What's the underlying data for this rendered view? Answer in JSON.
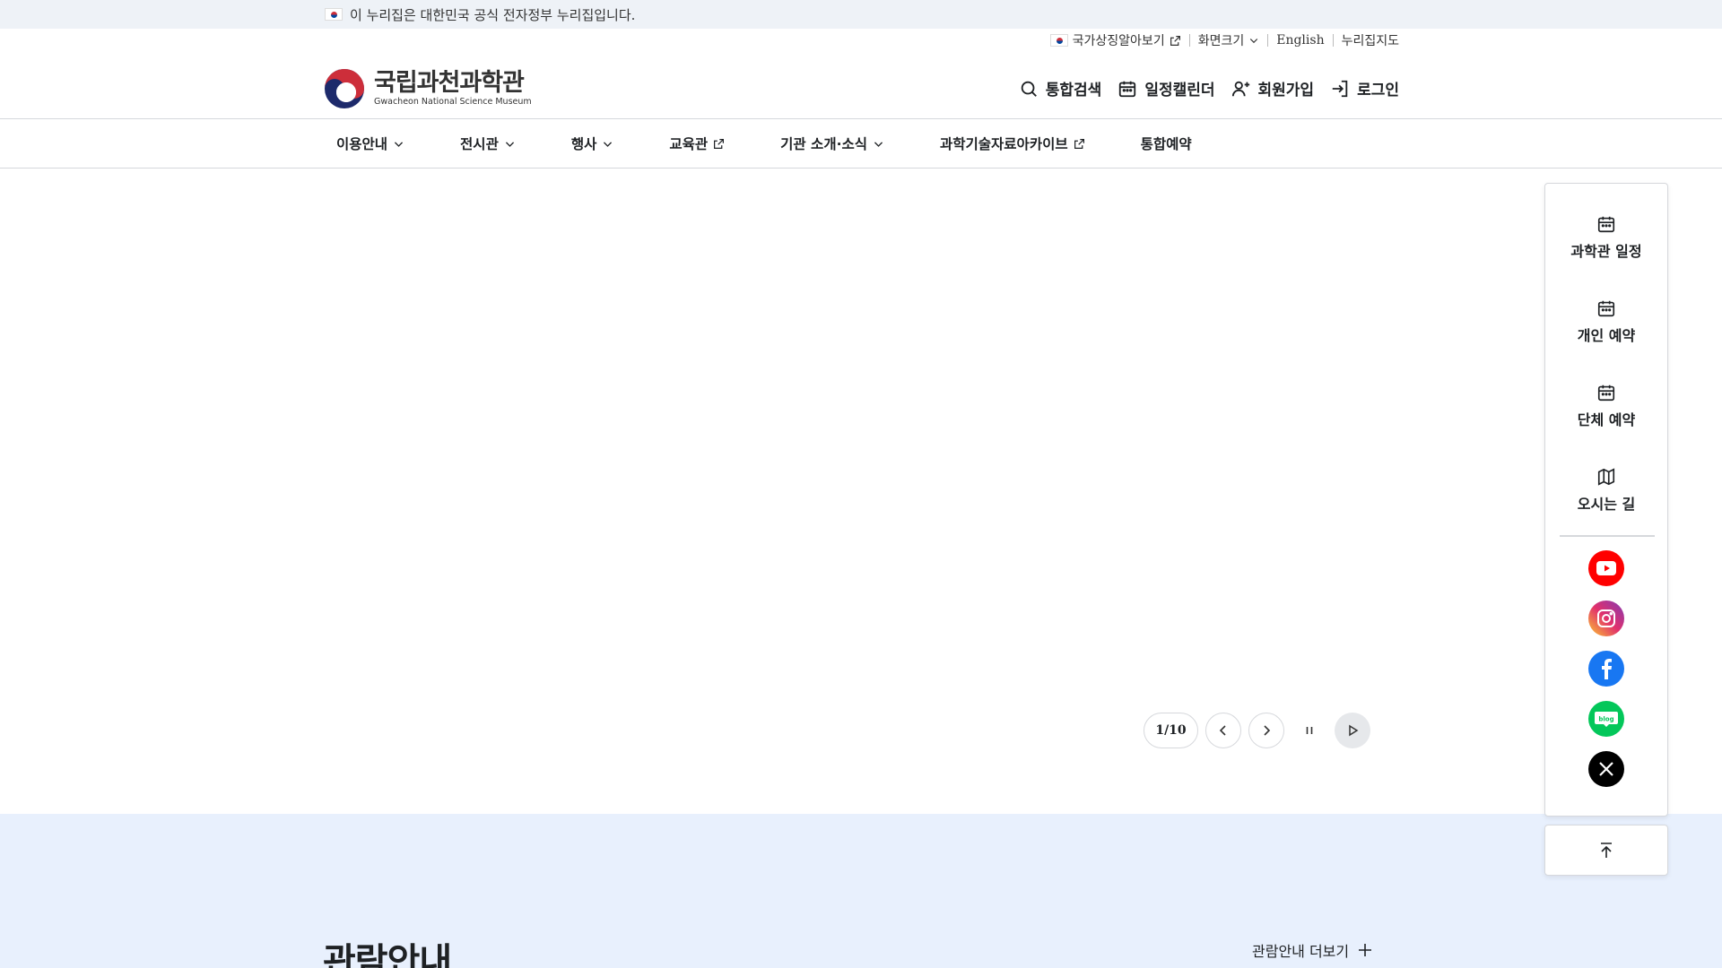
{
  "gov_banner": {
    "text": "이 누리집은 대한민국 공식 전자정부 누리집입니다."
  },
  "utility": {
    "symbols": "국가상징알아보기",
    "font_size": "화면크기",
    "english": "English",
    "sitemap": "누리집지도"
  },
  "logo": {
    "name_ko": "국립과천과학관",
    "name_en": "Gwacheon National Science Museum"
  },
  "header_actions": {
    "search": "통합검색",
    "calendar": "일정캘린더",
    "signup": "회원가입",
    "login": "로그인"
  },
  "gnb": {
    "items": [
      {
        "label": "이용안내",
        "icon": "chevron-down-icon"
      },
      {
        "label": "전시관",
        "icon": "chevron-down-icon"
      },
      {
        "label": "행사",
        "icon": "chevron-down-icon"
      },
      {
        "label": "교육관",
        "icon": "external-link-icon"
      },
      {
        "label": "기관 소개·소식",
        "icon": "chevron-down-icon"
      },
      {
        "label": "과학기술자료아카이브",
        "icon": "external-link-icon"
      },
      {
        "label": "통합예약",
        "icon": ""
      }
    ]
  },
  "slider": {
    "counter": "1/10"
  },
  "quick_menu": {
    "items": [
      {
        "label": "과학관 일정",
        "icon": "calendar-icon"
      },
      {
        "label": "개인 예약",
        "icon": "calendar-icon"
      },
      {
        "label": "단체 예약",
        "icon": "calendar-icon"
      },
      {
        "label": "오시는 길",
        "icon": "map-icon"
      }
    ],
    "sns": [
      {
        "name": "youtube-icon",
        "color": "#ff0000"
      },
      {
        "name": "instagram-icon",
        "color": "#e1306c"
      },
      {
        "name": "facebook-icon",
        "color": "#1877f2"
      },
      {
        "name": "blog-icon",
        "color": "#03c75a",
        "text": "blog"
      },
      {
        "name": "x-icon",
        "color": "#000000"
      }
    ]
  },
  "section": {
    "title": "관람안내",
    "more": "관람안내 더보기"
  },
  "colors": {
    "gov_banner_bg": "#eef2f7",
    "lower_bg": "#e8f0fd",
    "text": "#1e2124"
  }
}
